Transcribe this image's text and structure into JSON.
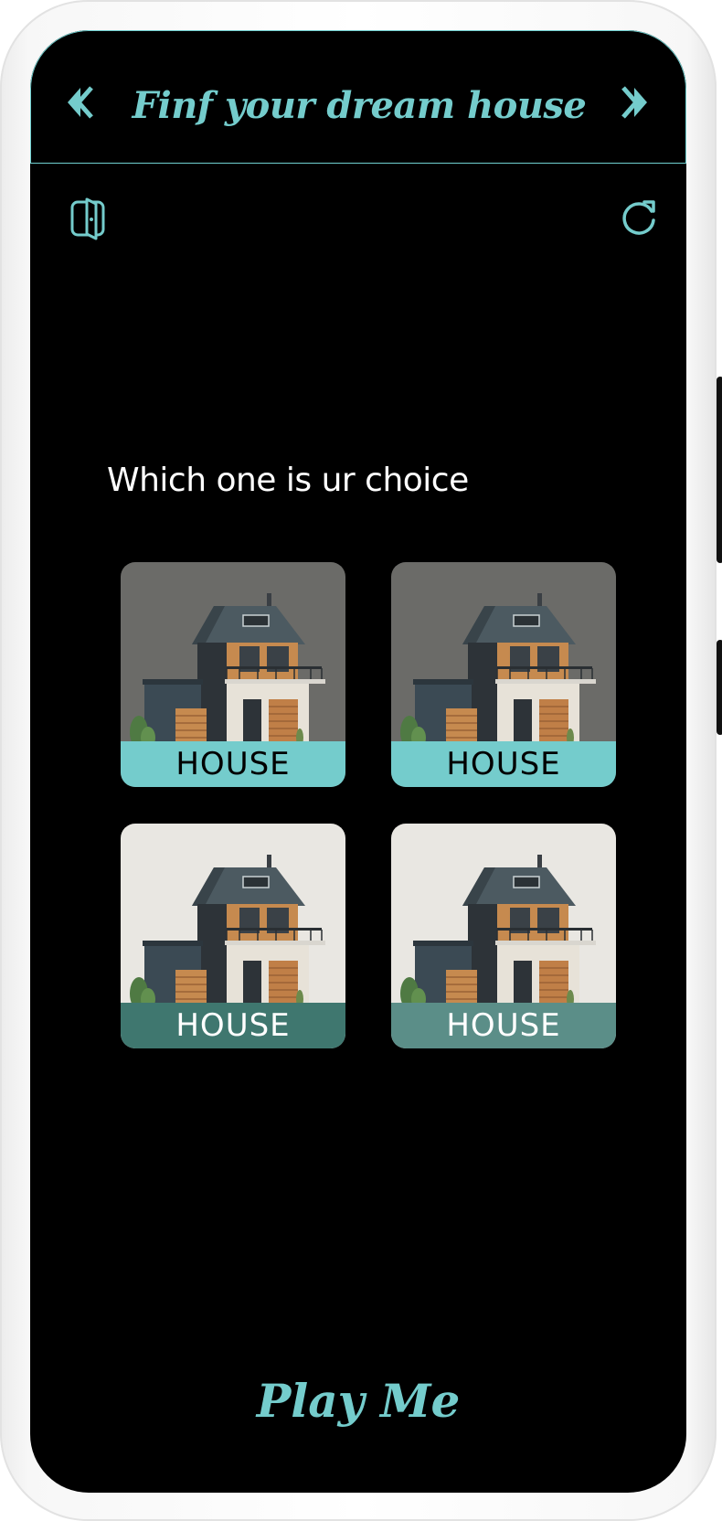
{
  "header": {
    "title": "Finf your dream house",
    "prev_icon": "double-chevron-left-icon",
    "next_icon": "double-chevron-right-icon"
  },
  "toolbar": {
    "exit_icon": "exit-door-icon",
    "restart_icon": "restart-icon"
  },
  "question": "Which one is ur choice",
  "options": [
    {
      "label": "HOUSE",
      "label_bg": "#74cccc",
      "label_color": "#000000",
      "photo_bg": "#6b6b68"
    },
    {
      "label": "HOUSE",
      "label_bg": "#74cccc",
      "label_color": "#000000",
      "photo_bg": "#6b6b68"
    },
    {
      "label": "HOUSE",
      "label_bg": "#3f776f",
      "label_color": "#ffffff",
      "photo_bg": "#e9e7e2"
    },
    {
      "label": "HOUSE",
      "label_bg": "#5b8e88",
      "label_color": "#ffffff",
      "photo_bg": "#e9e7e2"
    }
  ],
  "footer": {
    "play_label": "Play Me"
  },
  "colors": {
    "accent": "#74cccc",
    "screen_bg": "#000000"
  }
}
